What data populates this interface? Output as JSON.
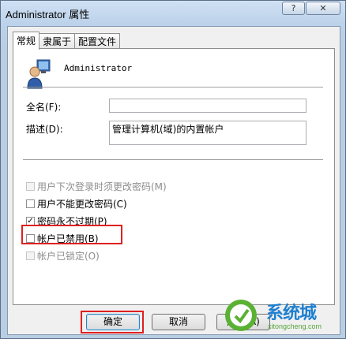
{
  "window": {
    "title": "Administrator 属性"
  },
  "tabs": [
    "常规",
    "隶属于",
    "配置文件"
  ],
  "user": {
    "name": "Administrator"
  },
  "fields": {
    "fullname": {
      "label": "全名(F):",
      "value": ""
    },
    "description": {
      "label": "描述(D):",
      "value": "管理计算机(域)的内置帐户"
    }
  },
  "checkboxes": [
    {
      "label": "用户下次登录时须更改密码(M)",
      "checked": false,
      "enabled": false
    },
    {
      "label": "用户不能更改密码(C)",
      "checked": false,
      "enabled": true
    },
    {
      "label": "密码永不过期(P)",
      "checked": true,
      "enabled": true
    },
    {
      "label": "帐户已禁用(B)",
      "checked": false,
      "enabled": true
    },
    {
      "label": "帐户已锁定(O)",
      "checked": false,
      "enabled": false
    }
  ],
  "buttons": {
    "ok": "确定",
    "cancel": "取消",
    "apply": "应用(A)",
    "help": "帮助"
  },
  "watermark": {
    "text": "系统城",
    "sub": "xitongcheng.com"
  },
  "colors": {
    "highlight": "#e02020",
    "brand": "#1f7fcf"
  }
}
